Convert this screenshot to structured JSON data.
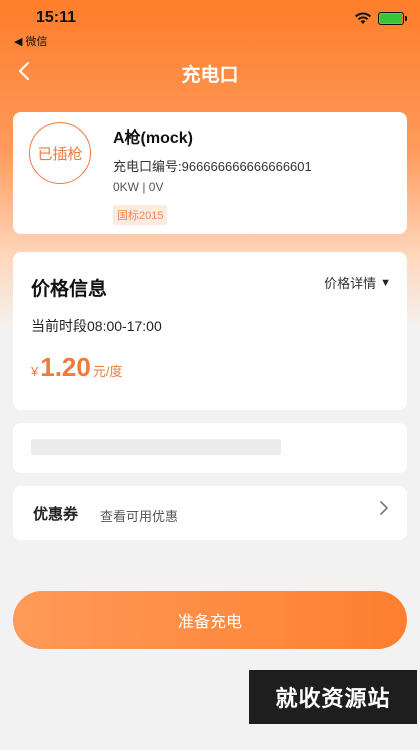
{
  "status_bar": {
    "time": "15:11",
    "back_app": "◀ 微信"
  },
  "nav": {
    "title": "充电口",
    "back_icon": "chevron-left-icon"
  },
  "gun": {
    "status": "已插枪",
    "name": "A枪(mock)",
    "code": "充电口编号:966666666666666601",
    "power": "0KW | 0V",
    "standard": "国标2015"
  },
  "price": {
    "title": "价格信息",
    "detail_label": "价格详情",
    "period": "当前时段08:00-17:00",
    "currency": "¥",
    "value": "1.20",
    "unit": "元/度"
  },
  "coupon": {
    "label": "优惠券",
    "hint": "查看可用优惠"
  },
  "action": {
    "charge_label": "准备充电"
  },
  "watermark": "就收资源站",
  "colors": {
    "accent": "#f07a3c",
    "header_gradient_top": "#fe7d2a",
    "button_start": "#fe9a58",
    "button_end": "#fe7f2f"
  }
}
